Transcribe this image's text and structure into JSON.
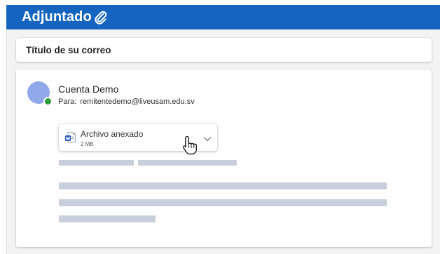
{
  "header": {
    "title": "Adjuntado",
    "icon": "paperclip-icon",
    "color": "#1565c0"
  },
  "subject": {
    "text": "Título de su correo"
  },
  "message": {
    "sender_name": "Cuenta Demo",
    "avatar_color": "#8fa8ea",
    "presence_status": "available",
    "presence_color": "#2e9e3a",
    "recipient_label": "Para:",
    "recipient_email": "remitentedemo@liveusam.edu.sv",
    "attachment": {
      "file_icon": "word-document-icon",
      "name": "Archivo anexado",
      "size": "2 MB",
      "menu_icon": "chevron-down-icon"
    },
    "cursor": "hand-pointer-icon",
    "placeholder_color": "#c8cedb"
  }
}
